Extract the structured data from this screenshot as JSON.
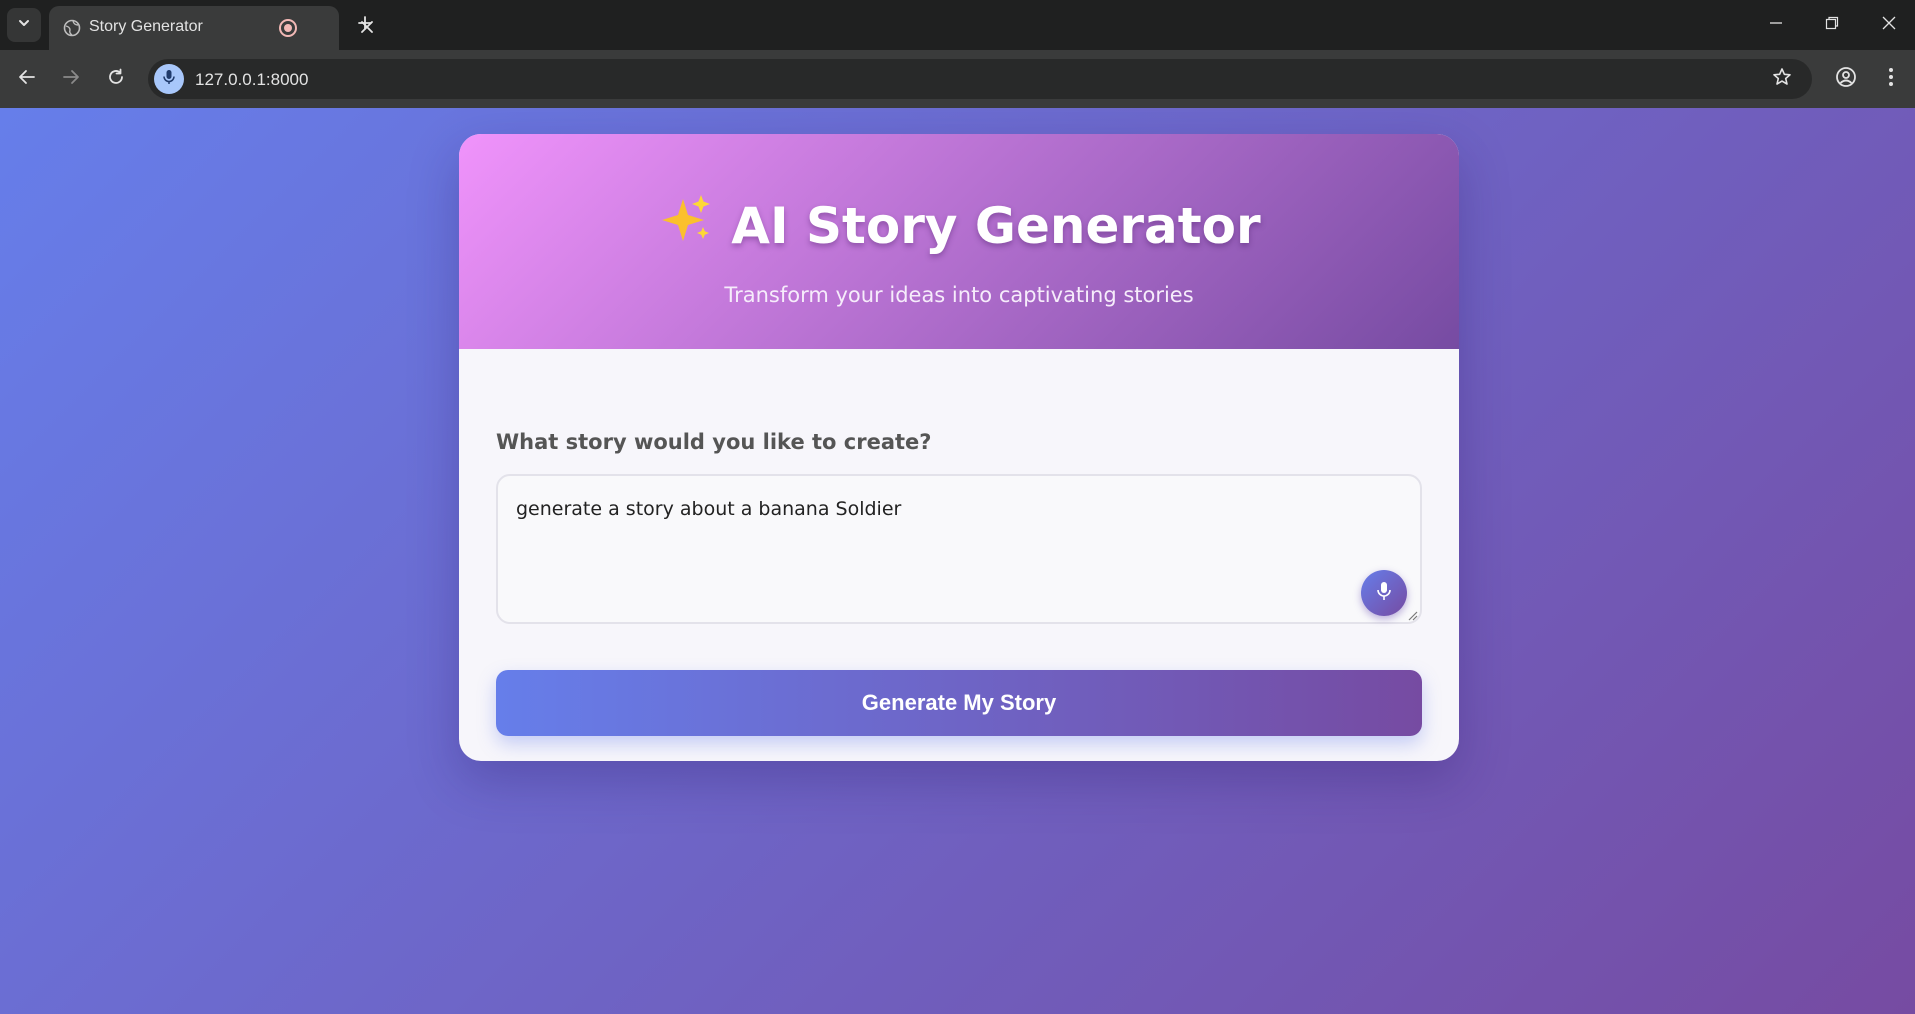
{
  "browser": {
    "tab_title": "Story Generator",
    "url": "127.0.0.1:8000"
  },
  "header": {
    "title": "AI Story Generator",
    "title_icon": "sparkles-icon",
    "subtitle": "Transform your ideas into captivating stories"
  },
  "form": {
    "label": "What story would you like to create?",
    "input_value": "generate a story about a banana Soldier",
    "mic_icon": "microphone-icon",
    "generate_label": "Generate My Story"
  },
  "colors": {
    "page_gradient_start": "#667eea",
    "page_gradient_end": "#764ba2",
    "header_gradient_start": "#f093fb",
    "header_gradient_end": "#764ba2"
  }
}
